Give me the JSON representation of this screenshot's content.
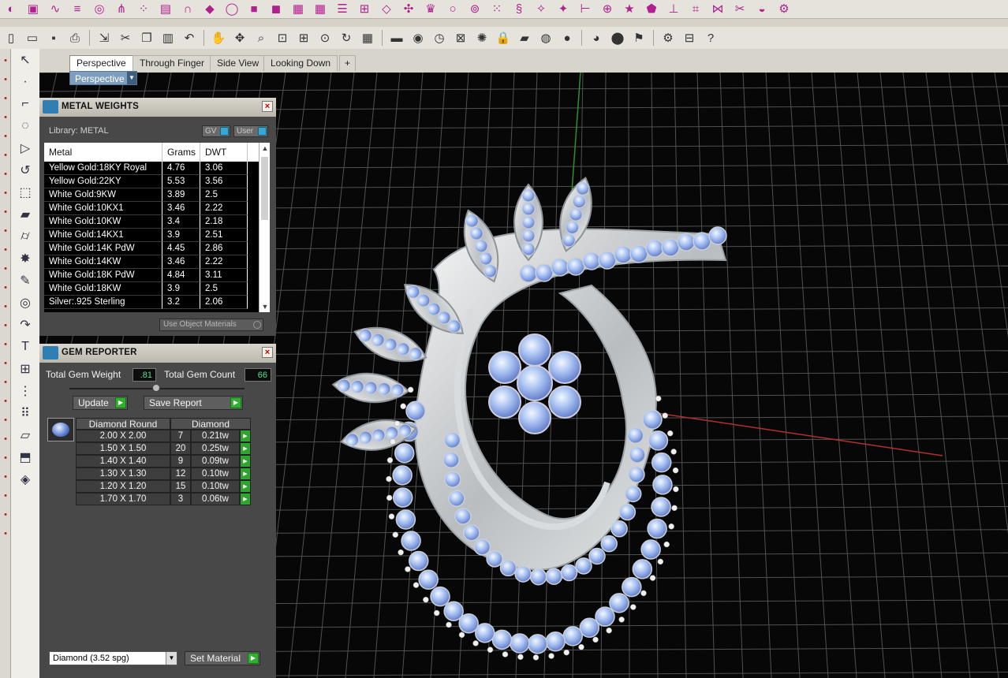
{
  "toolbar_top": {
    "icons": [
      "cut-plane-icon",
      "box-icon",
      "curve-icon",
      "rails-icon",
      "bezel-icon",
      "prong-icon",
      "pave-icon",
      "channel-icon",
      "arch-icon",
      "gem-cut-icon",
      "shank-icon",
      "cube-icon",
      "solid-icon",
      "array-icon",
      "grid-icon",
      "calendar-icon",
      "gallery-icon",
      "stone-icon",
      "prong-set-icon",
      "head-icon",
      "ring-icon",
      "band-icon",
      "pave-grid-icon",
      "twist-icon",
      "wand-icon",
      "sparkle-icon",
      "ruler-icon",
      "target-icon",
      "star-icon",
      "polygon-icon",
      "comb-icon",
      "mesh-icon",
      "net-icon",
      "scissors-icon",
      "cup-icon",
      "gear-icon"
    ]
  },
  "toolbar_standard": {
    "icons": [
      "new-icon",
      "open-icon",
      "save-icon",
      "print-icon",
      "export-icon",
      "cut-icon",
      "copy-icon",
      "paste-icon",
      "undo-icon",
      "pan-icon",
      "rotate-icon",
      "zoom-icon",
      "zoom-window-icon",
      "zoom-extents-icon",
      "zoom-selected-icon",
      "rotate-view-icon",
      "grid-icon",
      "car-icon",
      "eye-icon",
      "clock-icon",
      "named-view-icon",
      "light-icon",
      "lock-icon",
      "layer-icon",
      "color-wheel-icon",
      "shade-icon",
      "render-icon",
      "sphere-icon",
      "flag-icon",
      "options-icon",
      "properties-icon",
      "help-icon"
    ]
  },
  "viewport": {
    "tabs": [
      "Perspective",
      "Through Finger",
      "Side View",
      "Looking Down"
    ],
    "active_tab": 0,
    "add_tab": "+",
    "label": "Perspective"
  },
  "metal_weights": {
    "title": "METAL WEIGHTS",
    "library_label": "Library: METAL",
    "toggle_gv": "GV",
    "toggle_user": "User",
    "columns": [
      "Metal",
      "Grams",
      "DWT"
    ],
    "rows": [
      {
        "metal": "Yellow Gold:18KY Royal",
        "grams": "4.76",
        "dwt": "3.06"
      },
      {
        "metal": "Yellow Gold:22KY",
        "grams": "5.53",
        "dwt": "3.56"
      },
      {
        "metal": "White Gold:9KW",
        "grams": "3.89",
        "dwt": "2.5"
      },
      {
        "metal": "White Gold:10KX1",
        "grams": "3.46",
        "dwt": "2.22"
      },
      {
        "metal": "White Gold:10KW",
        "grams": "3.4",
        "dwt": "2.18"
      },
      {
        "metal": "White Gold:14KX1",
        "grams": "3.9",
        "dwt": "2.51"
      },
      {
        "metal": "White Gold:14K PdW",
        "grams": "4.45",
        "dwt": "2.86"
      },
      {
        "metal": "White Gold:14KW",
        "grams": "3.46",
        "dwt": "2.22"
      },
      {
        "metal": "White Gold:18K PdW",
        "grams": "4.84",
        "dwt": "3.11"
      },
      {
        "metal": "White Gold:18KW",
        "grams": "3.9",
        "dwt": "2.5"
      },
      {
        "metal": "Silver:.925 Sterling",
        "grams": "3.2",
        "dwt": "2.06"
      }
    ],
    "use_object_materials": "Use Object Materials"
  },
  "gem_reporter": {
    "title": "GEM REPORTER",
    "total_weight_label": "Total Gem Weight",
    "total_weight_value": ".81",
    "total_count_label": "Total Gem Count",
    "total_count_value": "66",
    "update_label": "Update",
    "save_report_label": "Save Report",
    "table_head_shape": "Diamond Round",
    "table_head_type": "Diamond",
    "rows": [
      {
        "size": "2.00 X 2.00",
        "count": "7",
        "weight": "0.21tw"
      },
      {
        "size": "1.50 X 1.50",
        "count": "20",
        "weight": "0.25tw"
      },
      {
        "size": "1.40 X 1.40",
        "count": "9",
        "weight": "0.09tw"
      },
      {
        "size": "1.30 X 1.30",
        "count": "12",
        "weight": "0.10tw"
      },
      {
        "size": "1.20 X 1.20",
        "count": "15",
        "weight": "0.10tw"
      },
      {
        "size": "1.70 X 1.70",
        "count": "3",
        "weight": "0.06tw"
      }
    ],
    "material_select": "Diamond    (3.52 spg)",
    "set_material_label": "Set Material"
  },
  "colors": {
    "toolbar_bg": "#e6e3dc",
    "panel_bg": "#484848",
    "viewport_bg": "#070707",
    "accent_blue": "#7e9ebd",
    "value_green": "#4fe09c",
    "go_green": "#30b030"
  }
}
